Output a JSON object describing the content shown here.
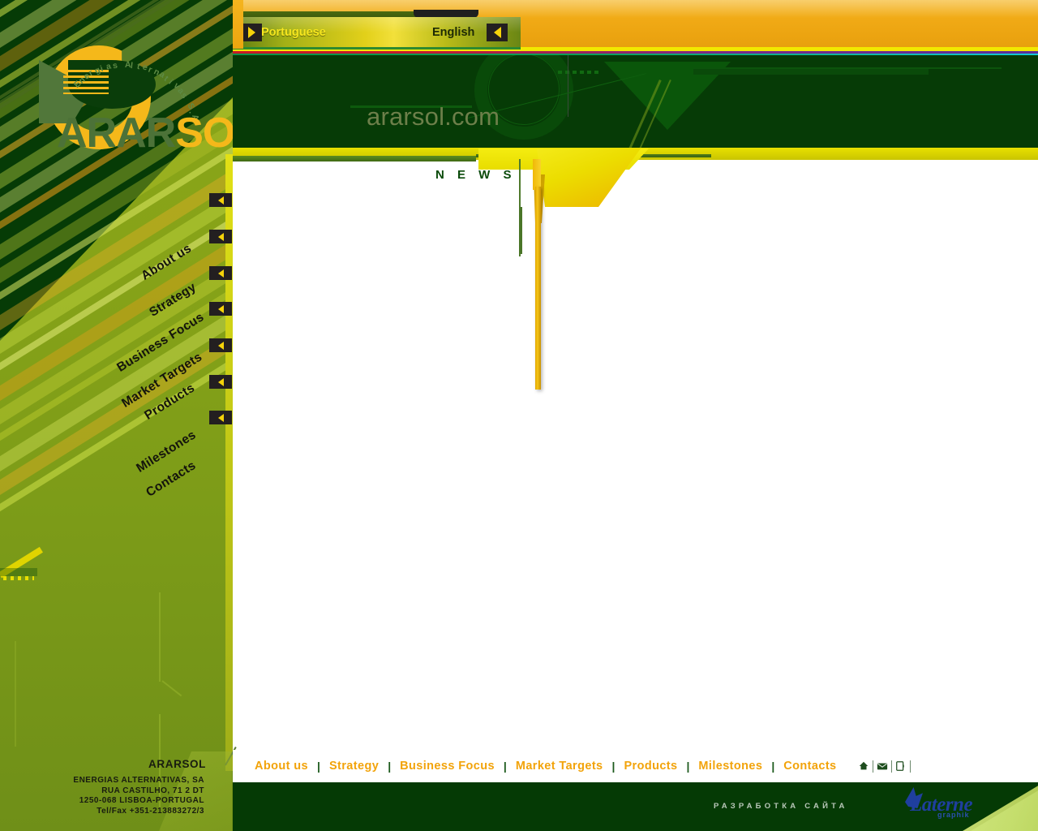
{
  "site": {
    "url_text": "ararsol.com",
    "brand": "ARARSOL",
    "brand_part1": "ARAR",
    "brand_part2": "SOL",
    "tagline": "Energias Alternativas S.A"
  },
  "language_bar": {
    "portuguese": "Portuguese",
    "english": "English",
    "pt_arrow_icon": "arrow-right-icon",
    "en_arrow_icon": "arrow-left-icon"
  },
  "sidebar": {
    "items": [
      {
        "label": "About us",
        "arrow_icon": "arrow-left-icon"
      },
      {
        "label": "Strategy",
        "arrow_icon": "arrow-left-icon"
      },
      {
        "label": "Business Focus",
        "arrow_icon": "arrow-left-icon"
      },
      {
        "label": "Market Targets",
        "arrow_icon": "arrow-left-icon"
      },
      {
        "label": "Products",
        "arrow_icon": "arrow-left-icon"
      },
      {
        "label": "Milestones",
        "arrow_icon": "arrow-left-icon"
      },
      {
        "label": "Contacts",
        "arrow_icon": "arrow-left-icon"
      }
    ]
  },
  "main": {
    "section_title": "N  E  W  S"
  },
  "footer_nav": {
    "links": [
      "About us",
      "Strategy",
      "Business Focus",
      "Market Targets",
      "Products",
      "Milestones",
      "Contacts"
    ],
    "separator": "|",
    "icons": [
      {
        "name": "home-icon",
        "glyph": "⌂"
      },
      {
        "name": "mail-icon",
        "glyph": "✉"
      },
      {
        "name": "print-icon",
        "glyph": "⎙"
      }
    ]
  },
  "address": {
    "company": "ARARSOL",
    "line1": "ENERGIAS ALTERNATIVAS, SA",
    "line2": "RUA CASTILHO, 71 2 DT",
    "line3": "1250-068 LISBOA-PORTUGAL",
    "line4": "Tel/Fax   +351-213883272/3"
  },
  "credit": {
    "text": "РАЗРАБОТКА  САЙТА",
    "studio_name": "Laterne",
    "studio_sub": "graphik"
  },
  "colors": {
    "orange_top": "#f0a915",
    "dark_green": "#063b06",
    "olive": "#87a318",
    "yellow": "#e8e000",
    "gold_link": "#f2a30a",
    "accent_red": "#c21b30",
    "accent_cyan": "#12c8d8"
  }
}
